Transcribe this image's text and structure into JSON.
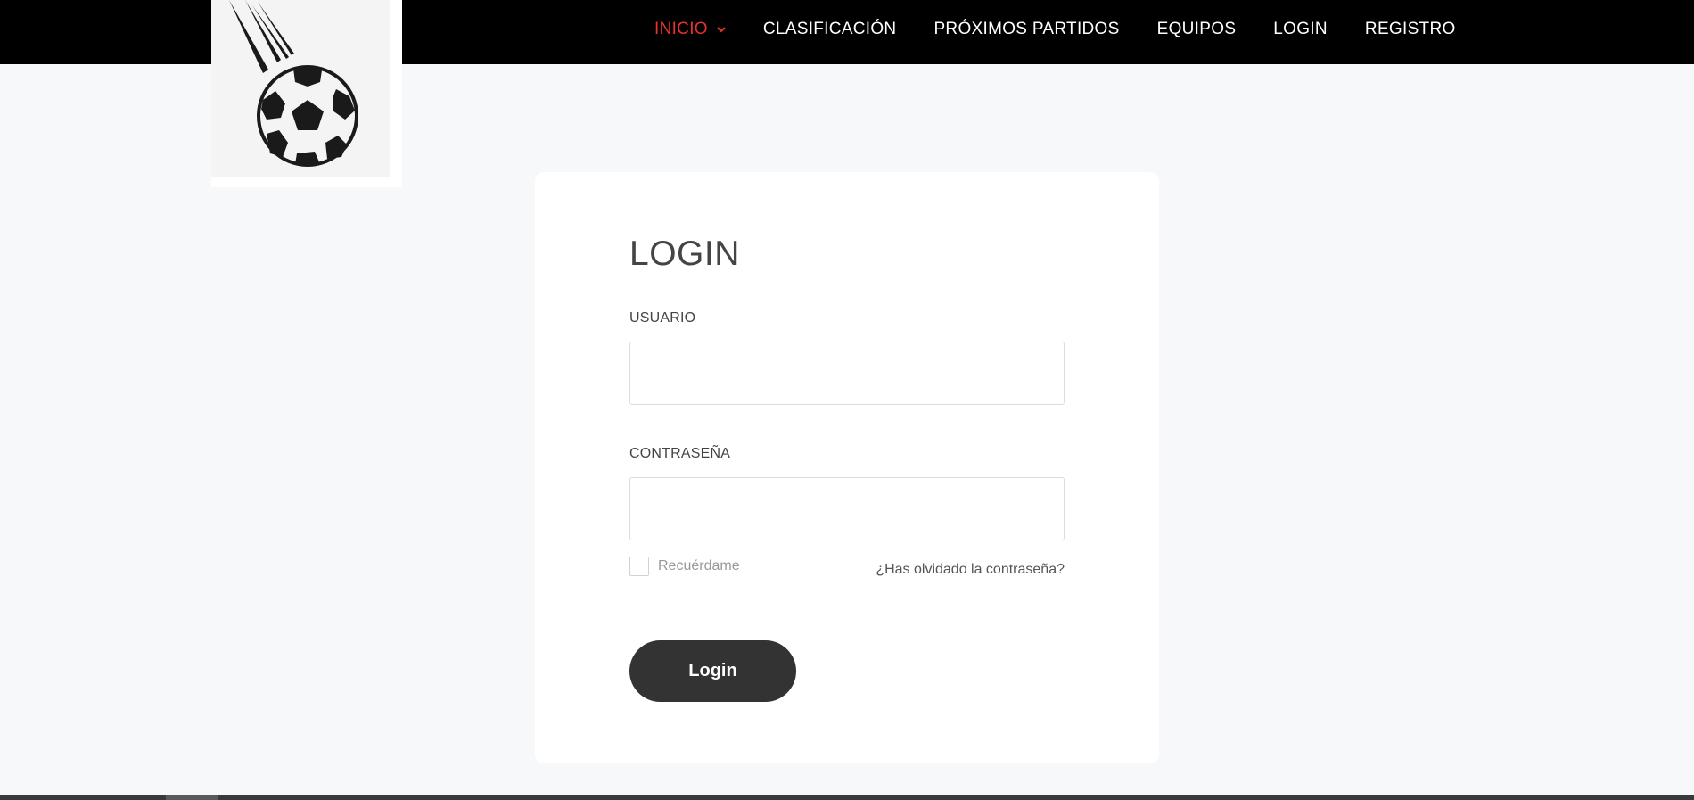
{
  "nav": {
    "items": [
      {
        "label": "INICIO",
        "active": true,
        "has_dropdown": true
      },
      {
        "label": "CLASIFICACIÓN"
      },
      {
        "label": "PRÓXIMOS PARTIDOS"
      },
      {
        "label": "EQUIPOS"
      },
      {
        "label": "LOGIN"
      },
      {
        "label": "REGISTRO"
      }
    ]
  },
  "logo": {
    "icon": "soccer-ball-icon"
  },
  "form": {
    "title": "LOGIN",
    "username_label": "USUARIO",
    "username_value": "",
    "password_label": "CONTRASEÑA",
    "password_value": "",
    "remember_label": "Recuérdame",
    "remember_checked": false,
    "forgot_link": "¿Has olvidado la contraseña?",
    "submit_label": "Login"
  },
  "colors": {
    "topbar": "#000000",
    "nav_active": "#e8322d",
    "page_bg": "#f7f8f9",
    "button_bg": "#333333"
  }
}
